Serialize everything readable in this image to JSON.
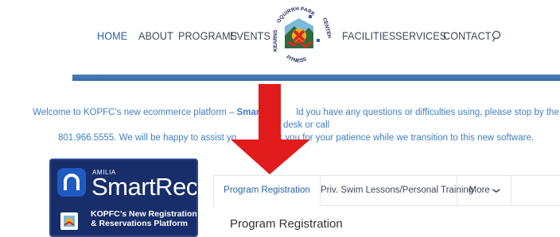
{
  "nav": {
    "items": [
      {
        "label": "HOME",
        "active": true
      },
      {
        "label": "ABOUT"
      },
      {
        "label": "PROGRAMS"
      },
      {
        "label": "EVENTS"
      },
      {
        "label": "FACILITIES"
      },
      {
        "label": "SERVICES"
      },
      {
        "label": "CONTACT"
      }
    ],
    "search_icon": "search-icon",
    "logo_text": {
      "top": "OQUIRRH PARK",
      "left": "KEARNS",
      "right": "CENTER",
      "bottom": "FITNESS"
    }
  },
  "welcome": {
    "prefix": "Welcome to KOPFC’s new ecommerce platform – ",
    "brand": "SmartR",
    "line1_tail": "ld you have any questions or difficulties using, please stop by the front desk or call",
    "line2_head": "801.966.5555.  We will be happy to assist yo",
    "line2_tail": "thank you for your patience while we transition to this new software."
  },
  "banner": {
    "small": "AMILIA",
    "big": "SmartRec",
    "tagline_1": "KOPFC’s New Registration",
    "tagline_2": "& Reservations Platform"
  },
  "tabs": [
    {
      "label": "Program Registration",
      "active": true
    },
    {
      "label": "Priv. Swim Lessons/Personal Training"
    },
    {
      "label": "More"
    }
  ],
  "section_title": "Program Registration",
  "colors": {
    "nav_text": "#3f4a5a",
    "nav_active": "#2a63a8",
    "blue_bar": "#3a6aa6",
    "welcome_text": "#3f7fc2",
    "arrow": "#e11b1b",
    "banner_bg": "#182e6a"
  }
}
